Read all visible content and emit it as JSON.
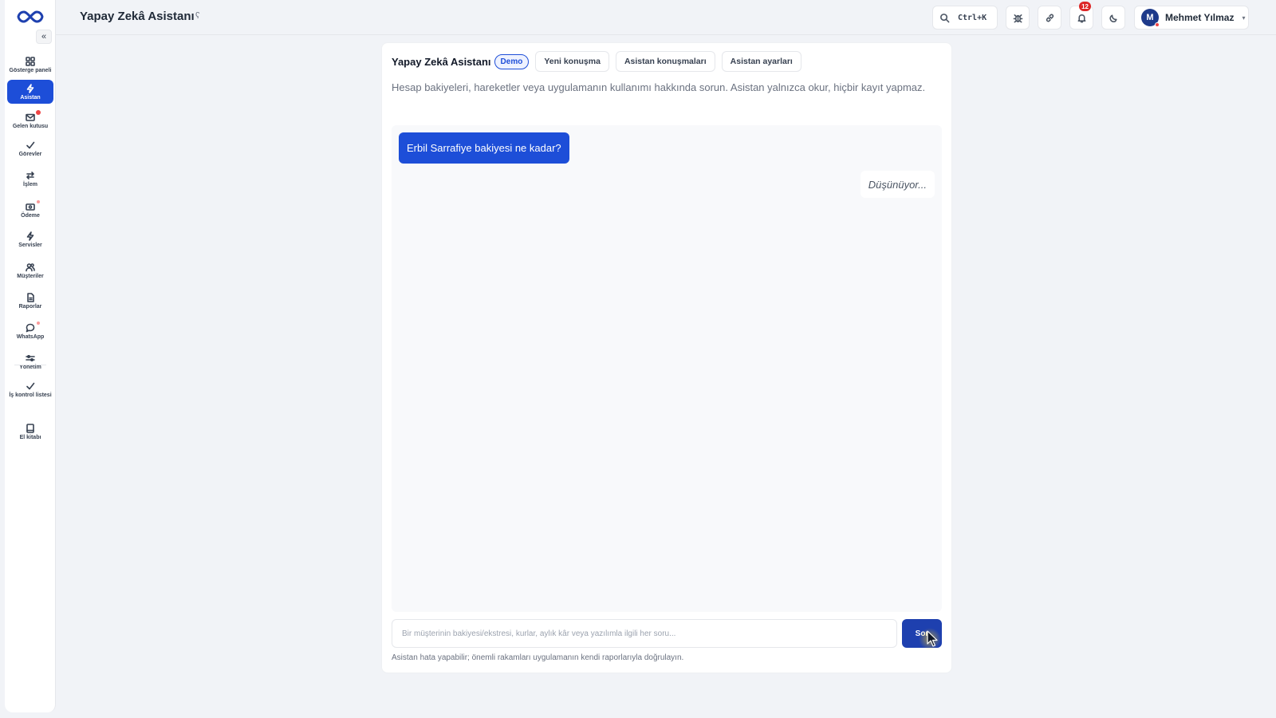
{
  "app": {
    "title": "Yapay Zekâ Asistanı",
    "title_icon": "ʕ"
  },
  "header": {
    "search_shortcut": "Ctrl+K",
    "notification_count": "12",
    "user": {
      "initial": "M",
      "name": "Mehmet Yılmaz"
    }
  },
  "sidebar": {
    "items": [
      {
        "label": "Gösterge paneli",
        "icon": "dashboard-icon"
      },
      {
        "label": "Asistan",
        "icon": "lightning-icon",
        "active": true
      },
      {
        "label": "Gelen kutusu",
        "icon": "inbox-icon"
      },
      {
        "label": "Görevler",
        "icon": "check-icon"
      },
      {
        "label": "İşlem",
        "icon": "transfer-icon"
      },
      {
        "label": "Ödeme",
        "icon": "payment-icon"
      },
      {
        "label": "Servisler",
        "icon": "lightning-icon"
      },
      {
        "label": "Müşteriler",
        "icon": "users-icon"
      },
      {
        "label": "Raporlar",
        "icon": "report-icon"
      },
      {
        "label": "WhatsApp",
        "icon": "chat-bubble-icon"
      },
      {
        "label": "Yönetim",
        "icon": "sliders-icon"
      },
      {
        "label": "İş kontrol listesi",
        "icon": "check-icon"
      },
      {
        "label": "El kitabı",
        "icon": "book-icon"
      }
    ]
  },
  "card": {
    "title": "Yapay Zekâ Asistanı",
    "badge": "Demo",
    "tabs": [
      "Yeni konuşma",
      "Asistan konuşmaları",
      "Asistan ayarları"
    ],
    "description": "Hesap bakiyeleri, hareketler veya uygulamanın kullanımı hakkında sorun. Asistan yalnızca okur, hiçbir kayıt yapmaz."
  },
  "chat": {
    "user_message": "Erbil Sarrafiye bakiyesi ne kadar?",
    "assistant_status": "Düşünüyor..."
  },
  "composer": {
    "placeholder": "Bir müşterinin bakiyesi/ekstresi, kurlar, aylık kâr veya yazılımla ilgili her soru...",
    "value": "",
    "send_label": "Sor",
    "disclaimer": "Asistan hata yapabilir; önemli rakamları uygulamanın kendi raporlarıyla doğrulayın."
  },
  "colors": {
    "accent": "#1d4ed8",
    "background": "#f1f3f7",
    "badge_red": "#dc2626"
  }
}
